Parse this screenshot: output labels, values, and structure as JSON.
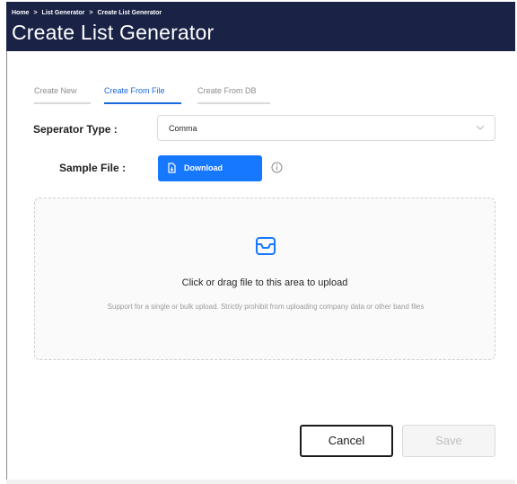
{
  "header": {
    "breadcrumb": [
      "Home",
      "List Generator",
      "Create List Generator"
    ],
    "breadcrumb_separator": ">",
    "title": "Create List Generator",
    "background_color": "#1a2346"
  },
  "tabs": [
    {
      "label": "Create New",
      "active": false
    },
    {
      "label": "Create From File",
      "active": true
    },
    {
      "label": "Create From DB",
      "active": false
    }
  ],
  "form": {
    "separator_type_label": "Seperator Type :",
    "separator_type_value": "Comma",
    "sample_file_label": "Sample File :",
    "download_label": "Download"
  },
  "upload": {
    "title": "Click or drag file to this area to upload",
    "hint": "Support for a single or bulk upload. Strictly prohibit from uploading company data or other band files"
  },
  "footer": {
    "cancel_label": "Cancel",
    "save_label": "Save",
    "save_disabled": true
  },
  "colors": {
    "accent": "#1677ff",
    "active_tab": "#1668dc"
  },
  "icons": {
    "select_arrow": "chevron-down-icon",
    "download": "file-download-icon",
    "info": "info-circle-icon",
    "upload_area": "inbox-icon"
  }
}
